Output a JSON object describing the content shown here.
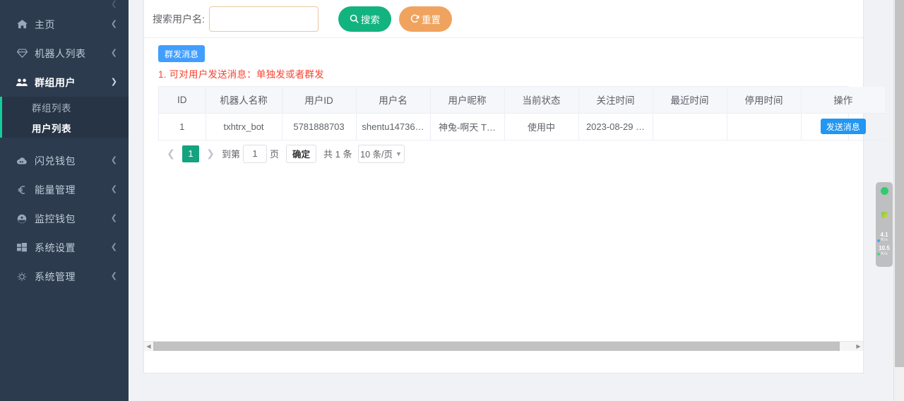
{
  "sidebar": {
    "collapse_icon": "chevron-left-icon",
    "items": [
      {
        "label": "主页",
        "icon": "home-icon",
        "arrow": "chevron-left-icon",
        "state": "collapsed"
      },
      {
        "label": "机器人列表",
        "icon": "diamond-icon",
        "arrow": "chevron-left-icon",
        "state": "collapsed"
      },
      {
        "label": "群组用户",
        "icon": "users-icon",
        "arrow": "chevron-down-icon",
        "state": "open"
      },
      {
        "label": "闪兑钱包",
        "icon": "cloud-icon",
        "arrow": "chevron-left-icon",
        "state": "collapsed"
      },
      {
        "label": "能量管理",
        "icon": "euro-icon",
        "arrow": "chevron-left-icon",
        "state": "collapsed"
      },
      {
        "label": "监控钱包",
        "icon": "monitor-wallet-icon",
        "arrow": "chevron-left-icon",
        "state": "collapsed"
      },
      {
        "label": "系统设置",
        "icon": "windows-grid-icon",
        "arrow": "chevron-left-icon",
        "state": "collapsed"
      },
      {
        "label": "系统管理",
        "icon": "gear-icon",
        "arrow": "chevron-left-icon",
        "state": "collapsed"
      }
    ],
    "submenu": [
      {
        "label": "群组列表",
        "active": false
      },
      {
        "label": "用户列表",
        "active": true
      }
    ],
    "colors": {
      "background": "#2c3b4d",
      "submenu_background": "#263445",
      "active_marker": "#13ce9a",
      "text": "#bfcbd9",
      "text_active": "#ffffff"
    }
  },
  "search": {
    "label": "搜索用户名:",
    "value": "",
    "placeholder": "",
    "search_button": {
      "label": "搜索",
      "icon": "search-icon",
      "color": "#13b37f"
    },
    "reset_button": {
      "label": "重置",
      "icon": "refresh-icon",
      "color": "#f0a35e"
    }
  },
  "toolbar": {
    "broadcast_button": {
      "label": "群发消息",
      "color": "#409eff"
    },
    "notice": "1. 可对用户发送消息：单独发或者群发",
    "notice_color": "#f9432e"
  },
  "table": {
    "columns": [
      "ID",
      "机器人名称",
      "用户ID",
      "用户名",
      "用户昵称",
      "当前状态",
      "关注时间",
      "最近时间",
      "停用时间",
      "操作"
    ],
    "rows": [
      {
        "id": "1",
        "bot_name": "txhtrx_bot",
        "user_id": "5781888703",
        "username": "shentu14736…",
        "nickname": "神兔-啊天 T…",
        "status": "使用中",
        "follow_time": "2023-08-29 …",
        "recent_time": "",
        "disabled_time": "",
        "action_label": "发送消息"
      }
    ]
  },
  "pagination": {
    "prev_icon": "chevron-left-icon",
    "next_icon": "chevron-right-icon",
    "current_page": "1",
    "jump_prefix": "到第",
    "jump_value": "1",
    "jump_suffix": "页",
    "confirm_label": "确定",
    "total_label": "共 1 条",
    "page_size_label": "10 条/页",
    "page_size_caret": "chevron-down-icon",
    "active_color": "#13a37f"
  },
  "scrollbars": {
    "horizontal_left_icon": "triangle-left-icon",
    "horizontal_right_icon": "triangle-right-icon"
  },
  "netspeed_widget": {
    "upload_value": "4.1",
    "upload_unit": "K/s",
    "download_value": "10.5",
    "download_unit": "K/s",
    "status_dot_color": "#2ecc71"
  }
}
